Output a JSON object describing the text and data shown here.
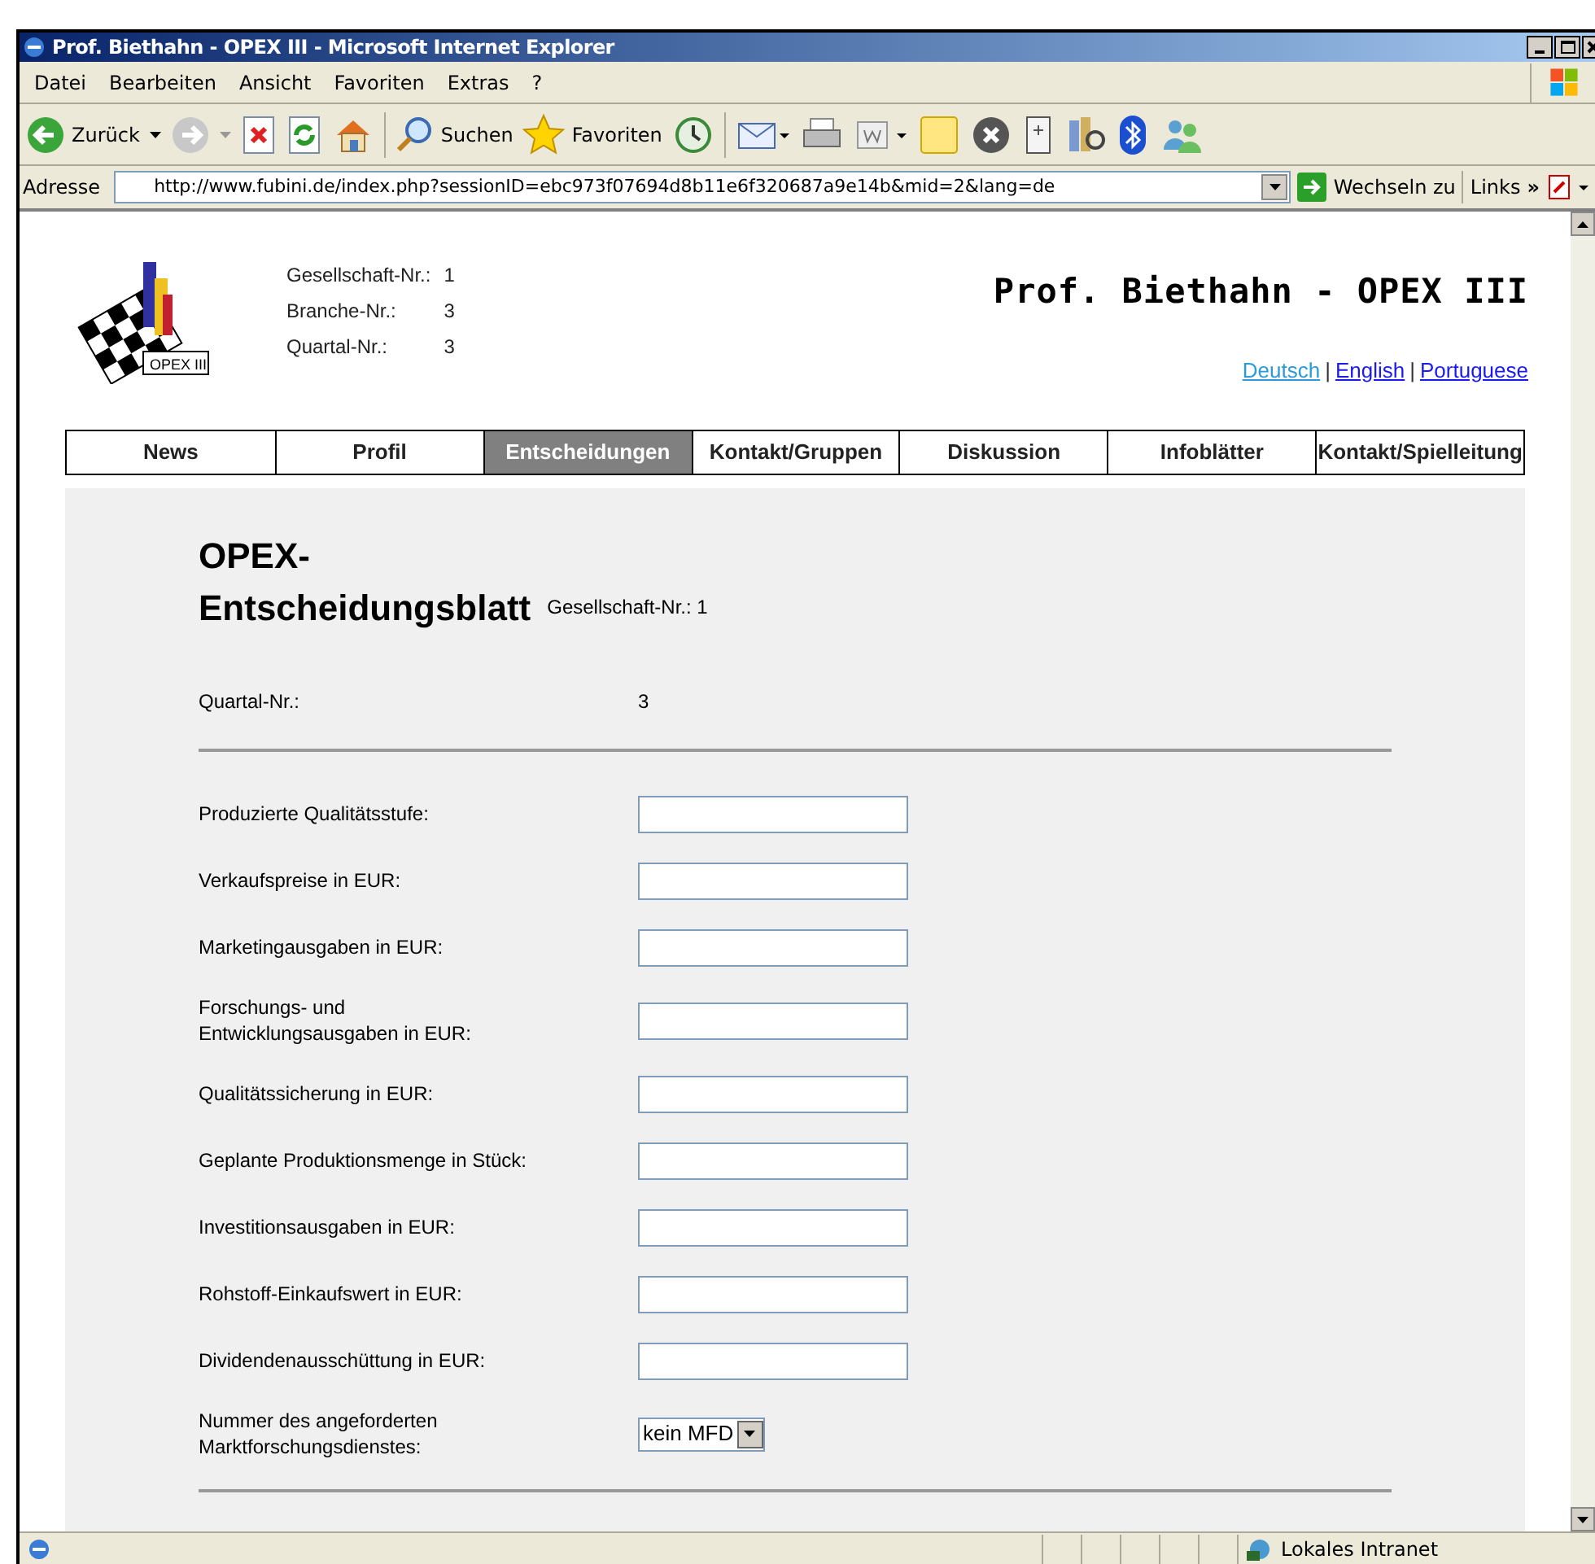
{
  "window": {
    "title": "Prof. Biethahn - OPEX III - Microsoft Internet Explorer"
  },
  "menu": [
    "Datei",
    "Bearbeiten",
    "Ansicht",
    "Favoriten",
    "Extras",
    "?"
  ],
  "toolbar": {
    "back": "Zurück",
    "search": "Suchen",
    "favorites": "Favoriten"
  },
  "address_bar": {
    "label": "Adresse",
    "url": "http://www.fubini.de/index.php?sessionID=ebc973f07694d8b11e6f320687a9e14b&mid=2&lang=de",
    "go": "Wechseln zu",
    "links": "Links",
    "more": "»"
  },
  "header": {
    "logo_text": "OPEX III",
    "info": [
      {
        "label": "Gesellschaft-Nr.:",
        "value": "1"
      },
      {
        "label": "Branche-Nr.:",
        "value": "3"
      },
      {
        "label": "Quartal-Nr.:",
        "value": "3"
      }
    ],
    "title": "Prof. Biethahn - OPEX III",
    "language_separator": "|",
    "languages": [
      {
        "label": "Deutsch",
        "visited": true
      },
      {
        "label": "English",
        "visited": false
      },
      {
        "label": "Portuguese",
        "visited": false
      }
    ]
  },
  "nav": [
    {
      "label": "News",
      "selected": false
    },
    {
      "label": "Profil",
      "selected": false
    },
    {
      "label": "Entscheidungen",
      "selected": true
    },
    {
      "label": "Kontakt/Gruppen",
      "selected": false
    },
    {
      "label": "Diskussion",
      "selected": false
    },
    {
      "label": "Infoblätter",
      "selected": false
    },
    {
      "label": "Kontakt/Spielleitung",
      "selected": false
    }
  ],
  "form": {
    "heading": "OPEX-\nEntscheidungsblatt",
    "company": "Gesellschaft-Nr.: 1",
    "quarter_label": "Quartal-Nr.:",
    "quarter_value": "3",
    "fields": [
      {
        "kind": "input",
        "label": "Produzierte Qualitätsstufe:"
      },
      {
        "kind": "input",
        "label": "Verkaufspreise in EUR:"
      },
      {
        "kind": "input",
        "label": "Marketingausgaben in EUR:"
      },
      {
        "kind": "input",
        "label": "Forschungs- und\nEntwicklungsausgaben in EUR:"
      },
      {
        "kind": "input",
        "label": "Qualitätssicherung in EUR:"
      },
      {
        "kind": "input",
        "label": "Geplante Produktionsmenge in Stück:"
      },
      {
        "kind": "input",
        "label": "Investitionsausgaben in EUR:"
      },
      {
        "kind": "input",
        "label": "Rohstoff-Einkaufswert in EUR:"
      },
      {
        "kind": "input",
        "label": "Dividendenausschüttung in EUR:"
      },
      {
        "kind": "select",
        "label": "Nummer des angeforderten\nMarktforschungsdienstes:",
        "value": "kein MFD"
      }
    ]
  },
  "status_bar": {
    "zone": "Lokales Intranet"
  }
}
